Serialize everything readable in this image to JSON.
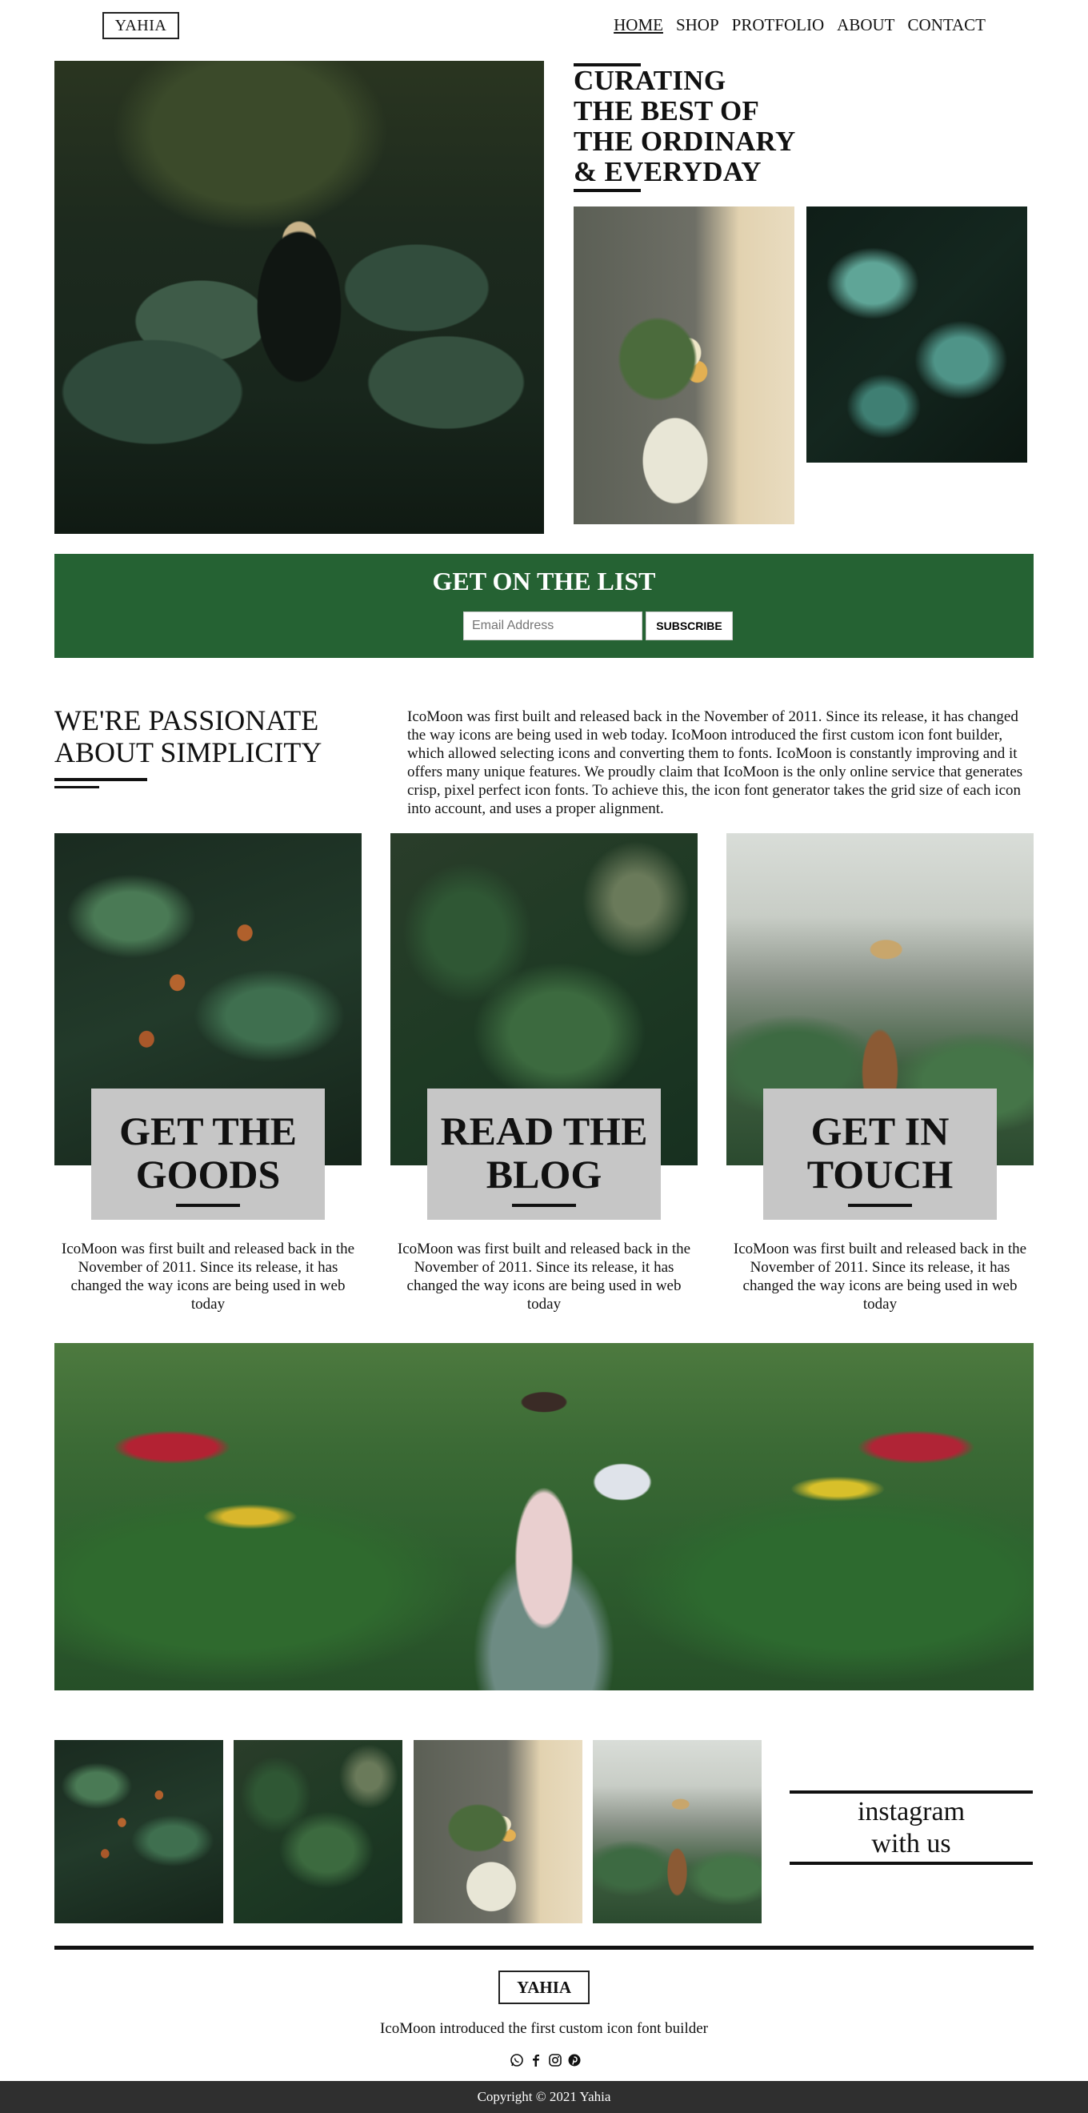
{
  "nav": {
    "logo": "YAHIA",
    "items": [
      "HOME",
      "SHOP",
      "PROTFOLIO",
      "ABOUT",
      "CONTACT"
    ]
  },
  "hero": {
    "title_lines": [
      "CURATING",
      "THE BEST OF",
      "THE ORDINARY",
      "& EVERYDAY"
    ]
  },
  "newsletter": {
    "title": "GET ON THE LIST",
    "email_placeholder": "Email Address",
    "button_label": "SUBSCRIBE"
  },
  "passion": {
    "title_lines": [
      "WE'RE PASSIONATE",
      "ABOUT SIMPLICITY"
    ],
    "text": "IcoMoon was first built and released back in the November of 2011. Since its release, it has changed the way icons are being used in web today. IcoMoon introduced the first custom icon font builder, which allowed selecting icons and converting them to fonts. IcoMoon is constantly improving and it offers many unique features. We proudly claim that IcoMoon is the only online service that generates crisp, pixel perfect icon fonts. To achieve this, the icon font generator takes the grid size of each icon into account, and uses a proper alignment."
  },
  "cards": [
    {
      "title_lines": [
        "GET THE",
        "GOODS"
      ],
      "text": "IcoMoon was first built and released back in the November of 2011. Since its release, it has changed the way icons are being used in web today"
    },
    {
      "title_lines": [
        "READ THE",
        "BLOG"
      ],
      "text": "IcoMoon was first built and released back in the November of 2011. Since its release, it has changed the way icons are being used in web today"
    },
    {
      "title_lines": [
        "GET IN",
        "TOUCH"
      ],
      "text": "IcoMoon was first built and released back in the November of 2011. Since its release, it has changed the way icons are being used in web today"
    }
  ],
  "instagram": {
    "lines": [
      "instagram",
      "with us"
    ]
  },
  "footer": {
    "logo": "YAHIA",
    "text": "IcoMoon introduced the first custom icon font builder",
    "social_icons": [
      "whatsapp-icon",
      "facebook-icon",
      "instagram-icon",
      "pinterest-icon"
    ],
    "copyright": "Copyright © 2021 Yahia"
  },
  "colors": {
    "accent_green": "#256233",
    "card_gray": "#c6c6c6",
    "footer_bar": "#2f2f2f"
  }
}
